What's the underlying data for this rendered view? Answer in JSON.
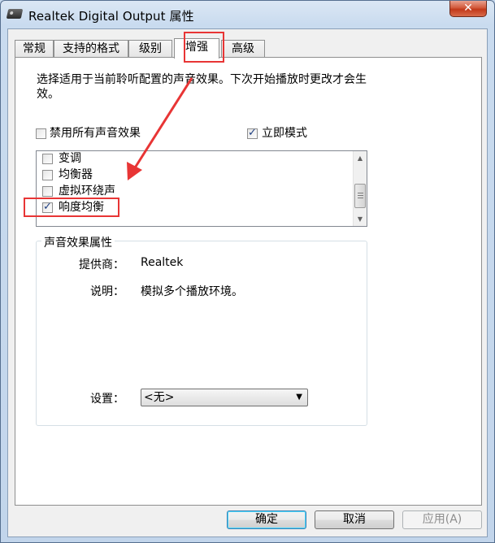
{
  "window": {
    "title": "Realtek Digital Output 属性",
    "close_label": "✕"
  },
  "tabs": [
    {
      "label": "常规"
    },
    {
      "label": "支持的格式"
    },
    {
      "label": "级别"
    },
    {
      "label": "增强"
    },
    {
      "label": "高级"
    }
  ],
  "active_tab": "增强",
  "enhancements": {
    "description": "选择适用于当前聆听配置的声音效果。下次开始播放时更改才会生效。",
    "disable_all": {
      "label": "禁用所有声音效果",
      "checked": false
    },
    "immediate_mode": {
      "label": "立即模式",
      "checked": true
    },
    "effects": [
      {
        "label": "变调",
        "checked": false
      },
      {
        "label": "均衡器",
        "checked": false
      },
      {
        "label": "虚拟环绕声",
        "checked": false
      },
      {
        "label": "响度均衡",
        "checked": true
      }
    ]
  },
  "properties": {
    "group_title": "声音效果属性",
    "provider_label": "提供商：",
    "provider_value": "Realtek",
    "description_label": "说明：",
    "description_value": "模拟多个播放环境。",
    "settings_label": "设置：",
    "settings_value": "<无>"
  },
  "buttons": {
    "ok": "确定",
    "cancel": "取消",
    "apply": "应用(A)"
  },
  "colors": {
    "annotation_red": "#e83535",
    "check_blue": "#1f3f82"
  }
}
